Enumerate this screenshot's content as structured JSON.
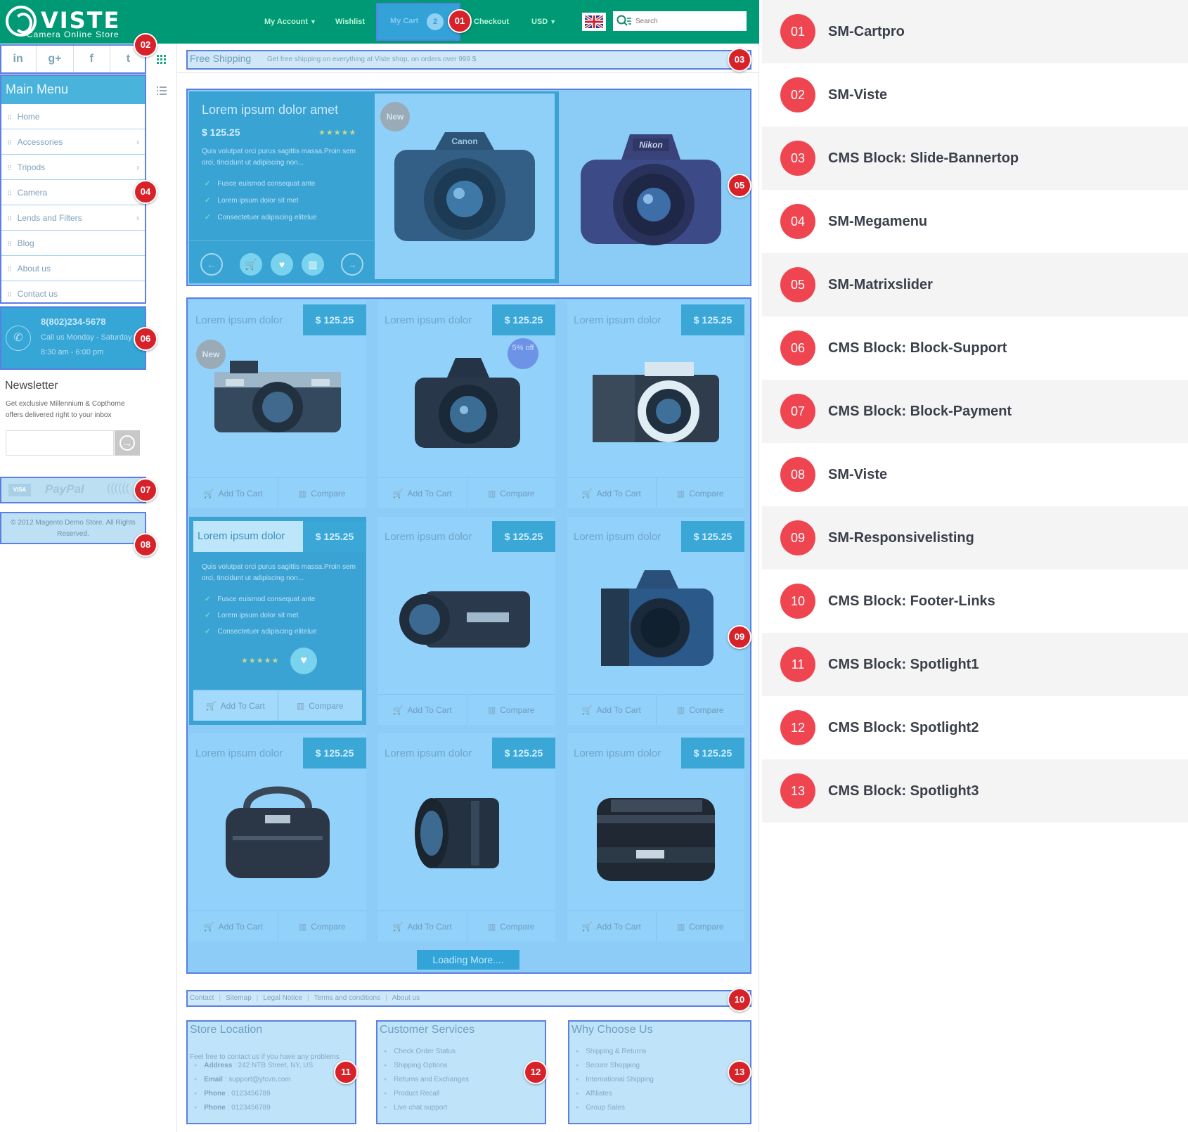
{
  "header": {
    "logo_name": "VISTE",
    "logo_tagline": "Camera Online Store",
    "nav": [
      "My Account",
      "Wishlist",
      "My Cart",
      "Checkout",
      "USD"
    ],
    "cart_count": "2",
    "search_placeholder": "Search"
  },
  "social": [
    "in",
    "g+",
    "f",
    "t"
  ],
  "main_menu": {
    "title": "Main Menu",
    "items": [
      {
        "label": "Home",
        "has_sub": false
      },
      {
        "label": "Accessories",
        "has_sub": true
      },
      {
        "label": "Tripods",
        "has_sub": true
      },
      {
        "label": "Camera",
        "has_sub": false
      },
      {
        "label": "Lends and Filters",
        "has_sub": true
      },
      {
        "label": "Blog",
        "has_sub": false
      },
      {
        "label": "About us",
        "has_sub": false
      },
      {
        "label": "Contact us",
        "has_sub": false
      }
    ]
  },
  "support": {
    "phone": "8(802)234-5678",
    "line1": "Call us Monday - Saturday",
    "line2": "8:30 am - 6:00 pm"
  },
  "newsletter": {
    "title": "Newsletter",
    "desc": "Get exclusive Millennium & Copthorne offers delivered right to your inbox"
  },
  "payment": {
    "visa": "VISA",
    "paypal": "PayPal"
  },
  "copyright": "© 2012 Magento Demo Store. All Rights Reserved.",
  "freeship": {
    "title": "Free Shipping",
    "desc": "Get free shipping on everything at Viste shop, on orders over 999 $"
  },
  "slider": {
    "title": "Lorem ipsum dolor amet",
    "price": "$ 125.25",
    "stars": "★★★★★",
    "desc": "Quis volutpat orci purus sagittis massa.Proin sem orci, tincidunt ut adipiscing non...",
    "features": [
      "Fusce euismod consequat ante",
      "Lorem ipsum dolor sit met",
      "Consectetuer adipiscing elitelue"
    ],
    "badge": "New",
    "brand_left": "Canon",
    "brand_right": "Nikon"
  },
  "products": [
    {
      "name": "Lorem ipsum dolor",
      "price": "$ 125.25",
      "badge": "New",
      "kind": "rangefinder"
    },
    {
      "name": "Lorem ipsum dolor",
      "price": "$ 125.25",
      "badge": "5% off",
      "kind": "dslr-nikon"
    },
    {
      "name": "Lorem ipsum dolor",
      "price": "$ 125.25",
      "badge": "",
      "kind": "mirrorless"
    },
    {
      "name": "Lorem ipsum dolor",
      "price": "$ 125.25",
      "badge": "",
      "kind": "hover"
    },
    {
      "name": "Lorem ipsum dolor",
      "price": "$ 125.25",
      "badge": "",
      "kind": "camcorder"
    },
    {
      "name": "Lorem ipsum dolor",
      "price": "$ 125.25",
      "badge": "",
      "kind": "dslr-pentax"
    },
    {
      "name": "Lorem ipsum dolor",
      "price": "$ 125.25",
      "badge": "",
      "kind": "bag"
    },
    {
      "name": "Lorem ipsum dolor",
      "price": "$ 125.25",
      "badge": "",
      "kind": "lens-short"
    },
    {
      "name": "Lorem ipsum dolor",
      "price": "$ 125.25",
      "badge": "",
      "kind": "lens-50"
    }
  ],
  "card_actions": {
    "add": "Add To Cart",
    "compare": "Compare"
  },
  "hover_card": {
    "desc": "Quis volutpat orci purus sagittis massa.Proin sem orci, tincidunt ut adipiscing non...",
    "features": [
      "Fusce euismod consequat ante",
      "Lorem ipsum dolor sit met",
      "Consectetuer adipiscing elitelue"
    ],
    "stars": "★★★★★"
  },
  "loading_more": "Loading More....",
  "footer_links": [
    "Contact",
    "Sitemap",
    "Legal Notice",
    "Terms and conditions",
    "About us"
  ],
  "spotlights": [
    {
      "title": "Store Location",
      "intro": "Feel free to contact us if you have any problems",
      "rows": [
        {
          "k": "Address",
          "v": " : 242 NTB Street, NY, US"
        },
        {
          "k": "Email",
          "v": " : support@ytcvn.com"
        },
        {
          "k": "Phone",
          "v": " : 0123456789"
        },
        {
          "k": "Phone",
          "v": " : 0123456789"
        }
      ]
    },
    {
      "title": "Customer Services",
      "intro": "",
      "rows": [
        {
          "k": "",
          "v": "Check Order Status"
        },
        {
          "k": "",
          "v": "Shipping Options"
        },
        {
          "k": "",
          "v": "Returns and Exchanges"
        },
        {
          "k": "",
          "v": "Product Recall"
        },
        {
          "k": "",
          "v": "Live chat support"
        }
      ]
    },
    {
      "title": "Why Choose Us",
      "intro": "",
      "rows": [
        {
          "k": "",
          "v": "Shipping & Returns"
        },
        {
          "k": "",
          "v": "Secure Shopping"
        },
        {
          "k": "",
          "v": "International Shipping"
        },
        {
          "k": "",
          "v": "Affiliates"
        },
        {
          "k": "",
          "v": "Group Sales"
        }
      ]
    }
  ],
  "badges": [
    "01",
    "02",
    "03",
    "04",
    "05",
    "06",
    "07",
    "08",
    "09",
    "10",
    "11",
    "12",
    "13"
  ],
  "legend": [
    {
      "num": "01",
      "label": "SM-Cartpro"
    },
    {
      "num": "02",
      "label": "SM-Viste"
    },
    {
      "num": "03",
      "label": "CMS Block: Slide-Bannertop"
    },
    {
      "num": "04",
      "label": "SM-Megamenu"
    },
    {
      "num": "05",
      "label": "SM-Matrixslider"
    },
    {
      "num": "06",
      "label": "CMS Block: Block-Support"
    },
    {
      "num": "07",
      "label": "CMS Block: Block-Payment"
    },
    {
      "num": "08",
      "label": "SM-Viste"
    },
    {
      "num": "09",
      "label": "SM-Responsivelisting"
    },
    {
      "num": "10",
      "label": "CMS Block: Footer-Links"
    },
    {
      "num": "11",
      "label": "CMS Block: Spotlight1"
    },
    {
      "num": "12",
      "label": "CMS Block: Spotlight2"
    },
    {
      "num": "13",
      "label": "CMS Block: Spotlight3"
    }
  ],
  "colors": {
    "header_green": "#009975",
    "overlay_blue": "#8dccf7",
    "panel_blue": "#39a3d4",
    "badge_red": "#d7222a",
    "legend_red": "#ef4550"
  }
}
